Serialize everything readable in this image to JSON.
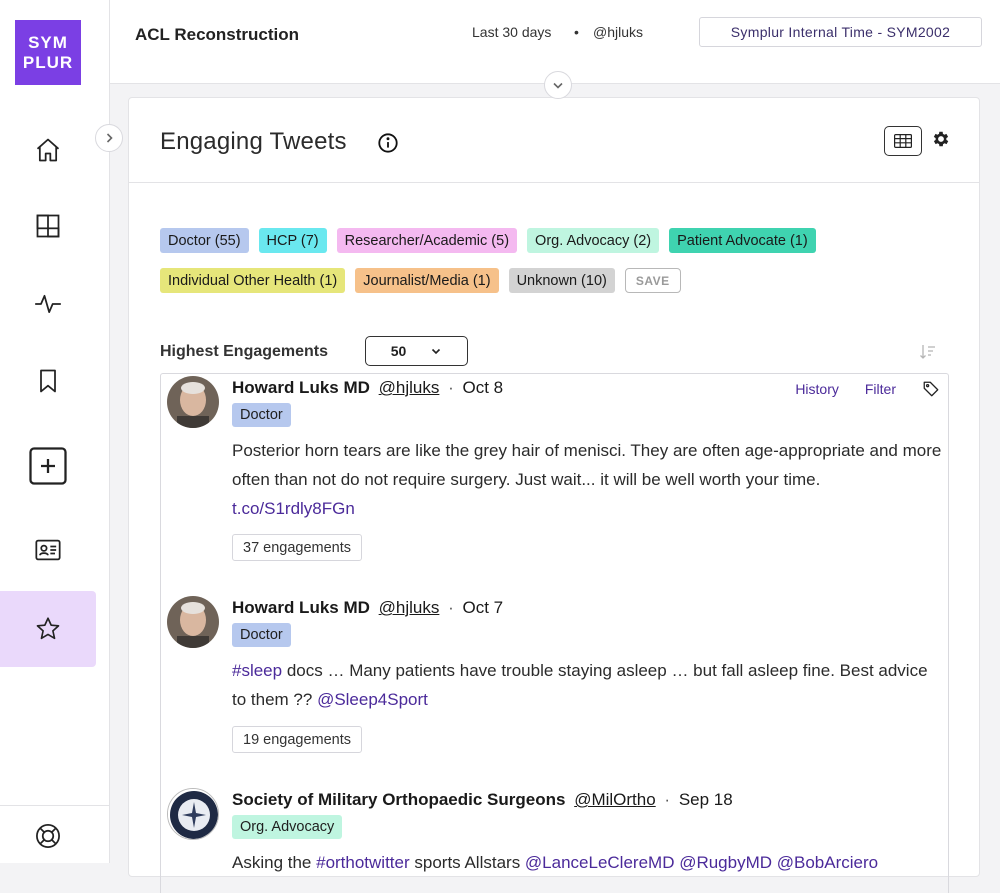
{
  "logo": {
    "line1": "SYM",
    "line2": "PLUR"
  },
  "colors": {
    "brand": "#7b3fe4",
    "active_nav": "#ead9fb",
    "link": "#4b2a9a"
  },
  "sidebar": {
    "items": [
      {
        "name": "home",
        "icon": "home-icon"
      },
      {
        "name": "dashboard",
        "icon": "layout-icon"
      },
      {
        "name": "activity",
        "icon": "pulse-icon"
      },
      {
        "name": "bookmarks",
        "icon": "bookmark-icon"
      },
      {
        "name": "add",
        "icon": "plus-square-icon"
      },
      {
        "name": "profiles",
        "icon": "id-card-icon"
      },
      {
        "name": "favorites",
        "icon": "star-icon",
        "active": true
      },
      {
        "name": "help",
        "icon": "lifebuoy-icon"
      }
    ]
  },
  "header": {
    "topic": "ACL Reconstruction",
    "range": "Last 30 days",
    "separator": "•",
    "handle": "@hjluks",
    "timezone": "Symplur Internal Time - SYM2002"
  },
  "card": {
    "title": "Engaging Tweets",
    "tags": [
      {
        "label": "Doctor (55)",
        "color": "#b6c8ee"
      },
      {
        "label": "HCP (7)",
        "color": "#6ae8ef"
      },
      {
        "label": "Researcher/Academic (5)",
        "color": "#f4b9f0"
      },
      {
        "label": "Org. Advocacy (2)",
        "color": "#bff5e0"
      },
      {
        "label": "Patient Advocate (1)",
        "color": "#3fd3b0"
      },
      {
        "label": "Individual Other Health (1)",
        "color": "#e6e67a"
      },
      {
        "label": "Journalist/Media (1)",
        "color": "#f6c18a"
      },
      {
        "label": "Unknown (10)",
        "color": "#d3d3d3"
      }
    ],
    "save_label": "SAVE",
    "engagement_label": "Highest Engagements",
    "count_value": "50"
  },
  "tweets": [
    {
      "name": "Howard Luks MD",
      "handle": "@hjluks",
      "sep": "·",
      "date": "Oct 8",
      "badge": "Doctor",
      "badge_color": "#b6c8ee",
      "text": "Posterior horn tears are like the grey hair of menisci. They are often age-appropriate and more often than not do not require surgery. Just wait... it will be well worth your time.",
      "link": "t.co/S1rdly8FGn",
      "engagements": "37 engagements",
      "actions": [
        "History",
        "Filter"
      ]
    },
    {
      "name": "Howard Luks MD",
      "handle": "@hjluks",
      "sep": "·",
      "date": "Oct 7",
      "badge": "Doctor",
      "badge_color": "#b6c8ee",
      "hashtag": "#sleep",
      "text": " docs … Many patients have trouble staying asleep … but fall asleep fine. Best advice to them ?? ",
      "mention": "@Sleep4Sport",
      "engagements": "19 engagements"
    },
    {
      "name": "Society of Military Orthopaedic Surgeons",
      "handle": "@MilOrtho",
      "sep": "·",
      "date": "Sep 18",
      "badge": "Org. Advocacy",
      "badge_color": "#bff5e0",
      "text_prefix": "Asking the ",
      "hashtag": "#orthotwitter",
      "text_mid": " sports Allstars ",
      "mentions": "@LanceLeClereMD @RugbyMD @BobArciero"
    }
  ]
}
